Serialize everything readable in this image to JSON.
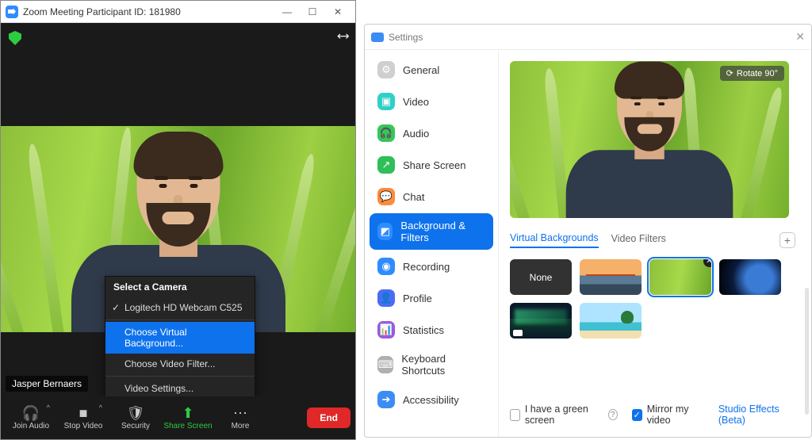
{
  "meeting": {
    "title": "Zoom Meeting Participant ID: 181980",
    "participant_name": "Jasper Bernaers",
    "end_label": "End",
    "toolbar": {
      "join_audio": "Join Audio",
      "stop_video": "Stop Video",
      "security": "Security",
      "share_screen": "Share Screen",
      "more": "More"
    },
    "camera_menu": {
      "heading": "Select a Camera",
      "selected_camera": "Logitech HD Webcam C525",
      "choose_bg": "Choose Virtual Background...",
      "choose_filter": "Choose Video Filter...",
      "video_settings": "Video Settings..."
    }
  },
  "settings": {
    "title": "Settings",
    "rotate_label": "Rotate 90°",
    "sidebar": [
      {
        "label": "General",
        "icon": "⚙",
        "color": "c-gray"
      },
      {
        "label": "Video",
        "icon": "▣",
        "color": "c-teal"
      },
      {
        "label": "Audio",
        "icon": "🎧",
        "color": "c-green"
      },
      {
        "label": "Share Screen",
        "icon": "↗",
        "color": "c-green2"
      },
      {
        "label": "Chat",
        "icon": "💬",
        "color": "c-orange"
      },
      {
        "label": "Background & Filters",
        "icon": "◩",
        "color": "c-blue",
        "active": true
      },
      {
        "label": "Recording",
        "icon": "◉",
        "color": "c-blue2"
      },
      {
        "label": "Profile",
        "icon": "👤",
        "color": "c-ind"
      },
      {
        "label": "Statistics",
        "icon": "📊",
        "color": "c-purple"
      },
      {
        "label": "Keyboard Shortcuts",
        "icon": "⌨",
        "color": "c-gray2"
      },
      {
        "label": "Accessibility",
        "icon": "➔",
        "color": "c-blue3"
      }
    ],
    "tabs": {
      "virtual_bg": "Virtual Backgrounds",
      "video_filters": "Video Filters"
    },
    "none_label": "None",
    "green_screen": "I have a green screen",
    "mirror": "Mirror my video",
    "studio": "Studio Effects (Beta)"
  }
}
